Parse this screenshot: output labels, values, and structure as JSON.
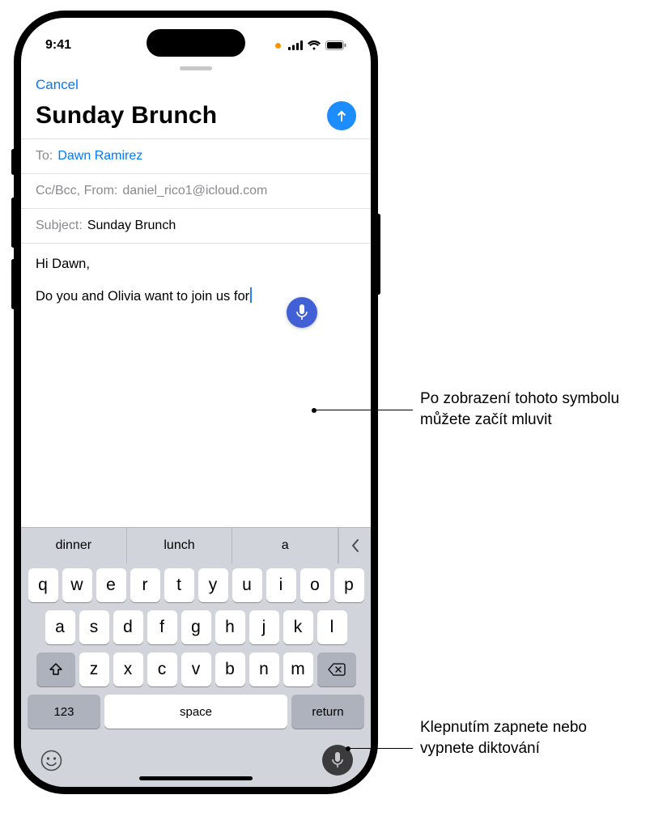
{
  "status": {
    "time": "9:41"
  },
  "compose": {
    "cancel": "Cancel",
    "title": "Sunday Brunch",
    "to_label": "To:",
    "to_value": "Dawn Ramirez",
    "ccbcc_label": "Cc/Bcc, From:",
    "from_value": "daniel_rico1@icloud.com",
    "subject_label": "Subject:",
    "subject_value": "Sunday Brunch",
    "body_line1": "Hi Dawn,",
    "body_line2": "Do you and Olivia want to join us for"
  },
  "keyboard": {
    "suggestions": [
      "dinner",
      "lunch",
      "a"
    ],
    "rows": {
      "r1": [
        "q",
        "w",
        "e",
        "r",
        "t",
        "y",
        "u",
        "i",
        "o",
        "p"
      ],
      "r2": [
        "a",
        "s",
        "d",
        "f",
        "g",
        "h",
        "j",
        "k",
        "l"
      ],
      "r3": [
        "z",
        "x",
        "c",
        "v",
        "b",
        "n",
        "m"
      ]
    },
    "key123": "123",
    "space": "space",
    "return": "return"
  },
  "callouts": {
    "dictation_active": "Po zobrazení tohoto symbolu můžete začít mluvit",
    "mic_button": "Klepnutím zapnete nebo vypnete diktování"
  }
}
